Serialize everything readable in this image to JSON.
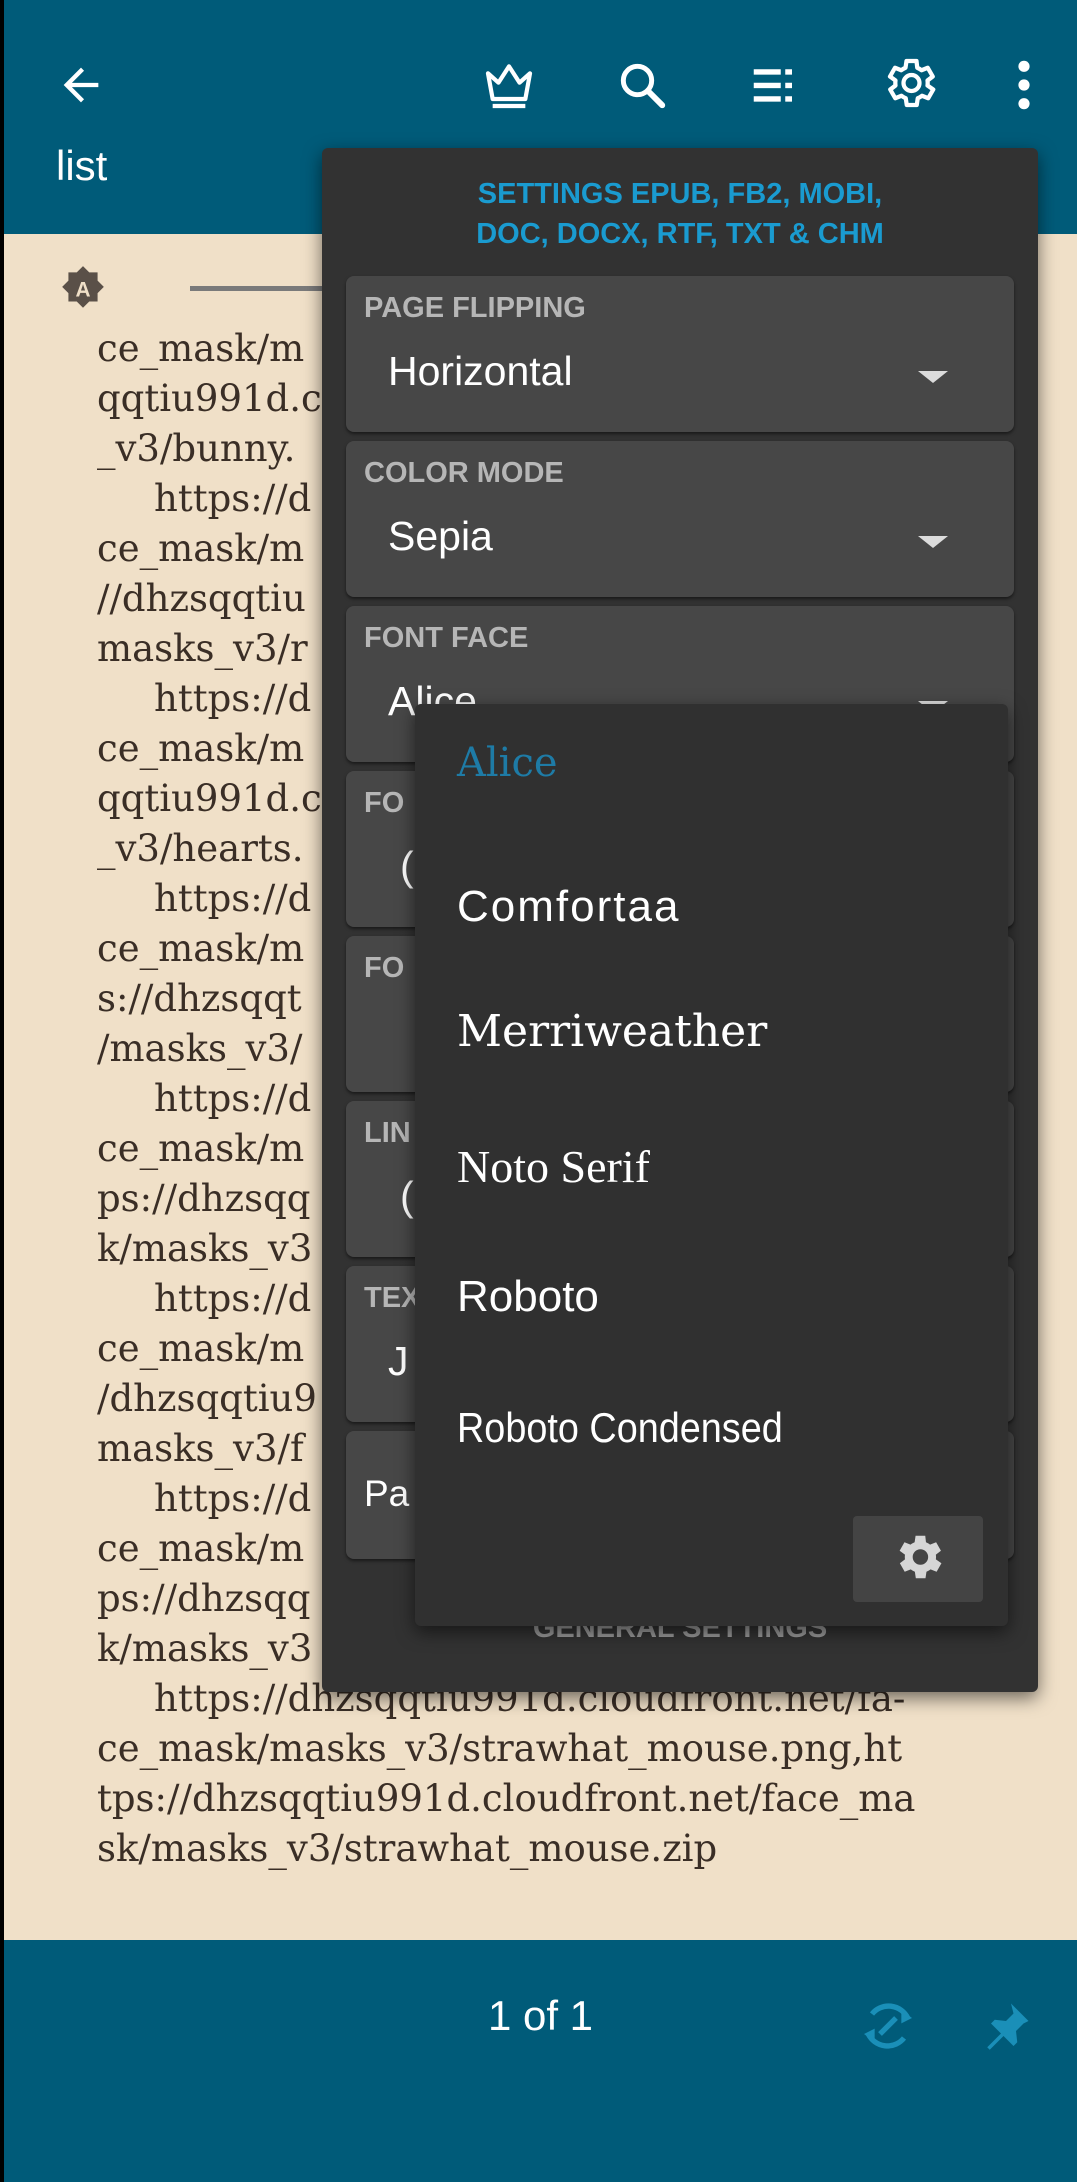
{
  "appbar": {
    "title": "list",
    "icons": [
      "back-arrow-icon",
      "crown-icon",
      "search-icon",
      "list-menu-icon",
      "gear-icon",
      "overflow-menu-icon"
    ]
  },
  "reader": {
    "badge_letter": "A",
    "lines": [
      {
        "text": "ce_mask/m",
        "indent": false
      },
      {
        "text": "qqtiu991d.c",
        "indent": false
      },
      {
        "text": "_v3/bunny.",
        "indent": false
      },
      {
        "text": "https://d",
        "indent": true
      },
      {
        "text": "ce_mask/m",
        "indent": false
      },
      {
        "text": "//dhzsqqtiu",
        "indent": false
      },
      {
        "text": "masks_v3/r",
        "indent": false
      },
      {
        "text": "https://d",
        "indent": true
      },
      {
        "text": "ce_mask/m",
        "indent": false
      },
      {
        "text": "qqtiu991d.c",
        "indent": false
      },
      {
        "text": "_v3/hearts.",
        "indent": false
      },
      {
        "text": "https://d",
        "indent": true
      },
      {
        "text": "ce_mask/m",
        "indent": false
      },
      {
        "text": "s://dhzsqqt",
        "indent": false
      },
      {
        "text": "/masks_v3/",
        "indent": false
      },
      {
        "text": "https://d",
        "indent": true
      },
      {
        "text": "ce_mask/m",
        "indent": false
      },
      {
        "text": "ps://dhzsqq",
        "indent": false
      },
      {
        "text": "k/masks_v3",
        "indent": false
      },
      {
        "text": "https://d",
        "indent": true
      },
      {
        "text": "ce_mask/m",
        "indent": false
      },
      {
        "text": "/dhzsqqtiu9",
        "indent": false
      },
      {
        "text": "masks_v3/f",
        "indent": false
      },
      {
        "text": "https://d",
        "indent": true
      },
      {
        "text": "ce_mask/m",
        "indent": false
      },
      {
        "text": "ps://dhzsqq",
        "indent": false
      },
      {
        "text": "k/masks_v3",
        "indent": false
      },
      {
        "text": "https://dhzsqqtiu991d.cloudfront.net/fa-",
        "indent": true
      },
      {
        "text": "ce_mask/masks_v3/strawhat_mouse.png,ht",
        "indent": false
      },
      {
        "text": "tps://dhzsqqtiu991d.cloudfront.net/face_ma",
        "indent": false
      },
      {
        "text": "sk/masks_v3/strawhat_mouse.zip",
        "indent": false
      }
    ]
  },
  "bottombar": {
    "pager": "1 of 1",
    "icons": [
      "sync-icon",
      "pin-icon"
    ]
  },
  "settings": {
    "heading_line1": "SETTINGS EPUB, FB2, MOBI,",
    "heading_line2": "DOC, DOCX, RTF, TXT & CHM",
    "page_flipping": {
      "label": "PAGE FLIPPING",
      "value": "Horizontal"
    },
    "color_mode": {
      "label": "COLOR MODE",
      "value": "Sepia"
    },
    "font_face": {
      "label": "FONT FACE",
      "value": "Alice"
    },
    "stubs": {
      "font_size": "FO",
      "font_size_value": "(",
      "font_weight": "FO",
      "line_spacing": "LIN",
      "line_spacing_value": "(",
      "text_align": "TEX",
      "text_align_value": "J",
      "pa": "Pa"
    },
    "general_settings": "GENERAL SETTINGS"
  },
  "font_dropdown": {
    "options": [
      "Alice",
      "Comfortaa",
      "Merriweather",
      "Noto Serif",
      "Roboto",
      "Roboto Condensed"
    ],
    "selected": "Alice",
    "settings_icon": "gear-icon"
  },
  "colors": {
    "appbar": "#005b79",
    "page_background": "#f0e0c8",
    "panel": "#323232",
    "card": "#474747",
    "accent": "#1a9bd0",
    "selected_option": "#1e7ba6"
  }
}
